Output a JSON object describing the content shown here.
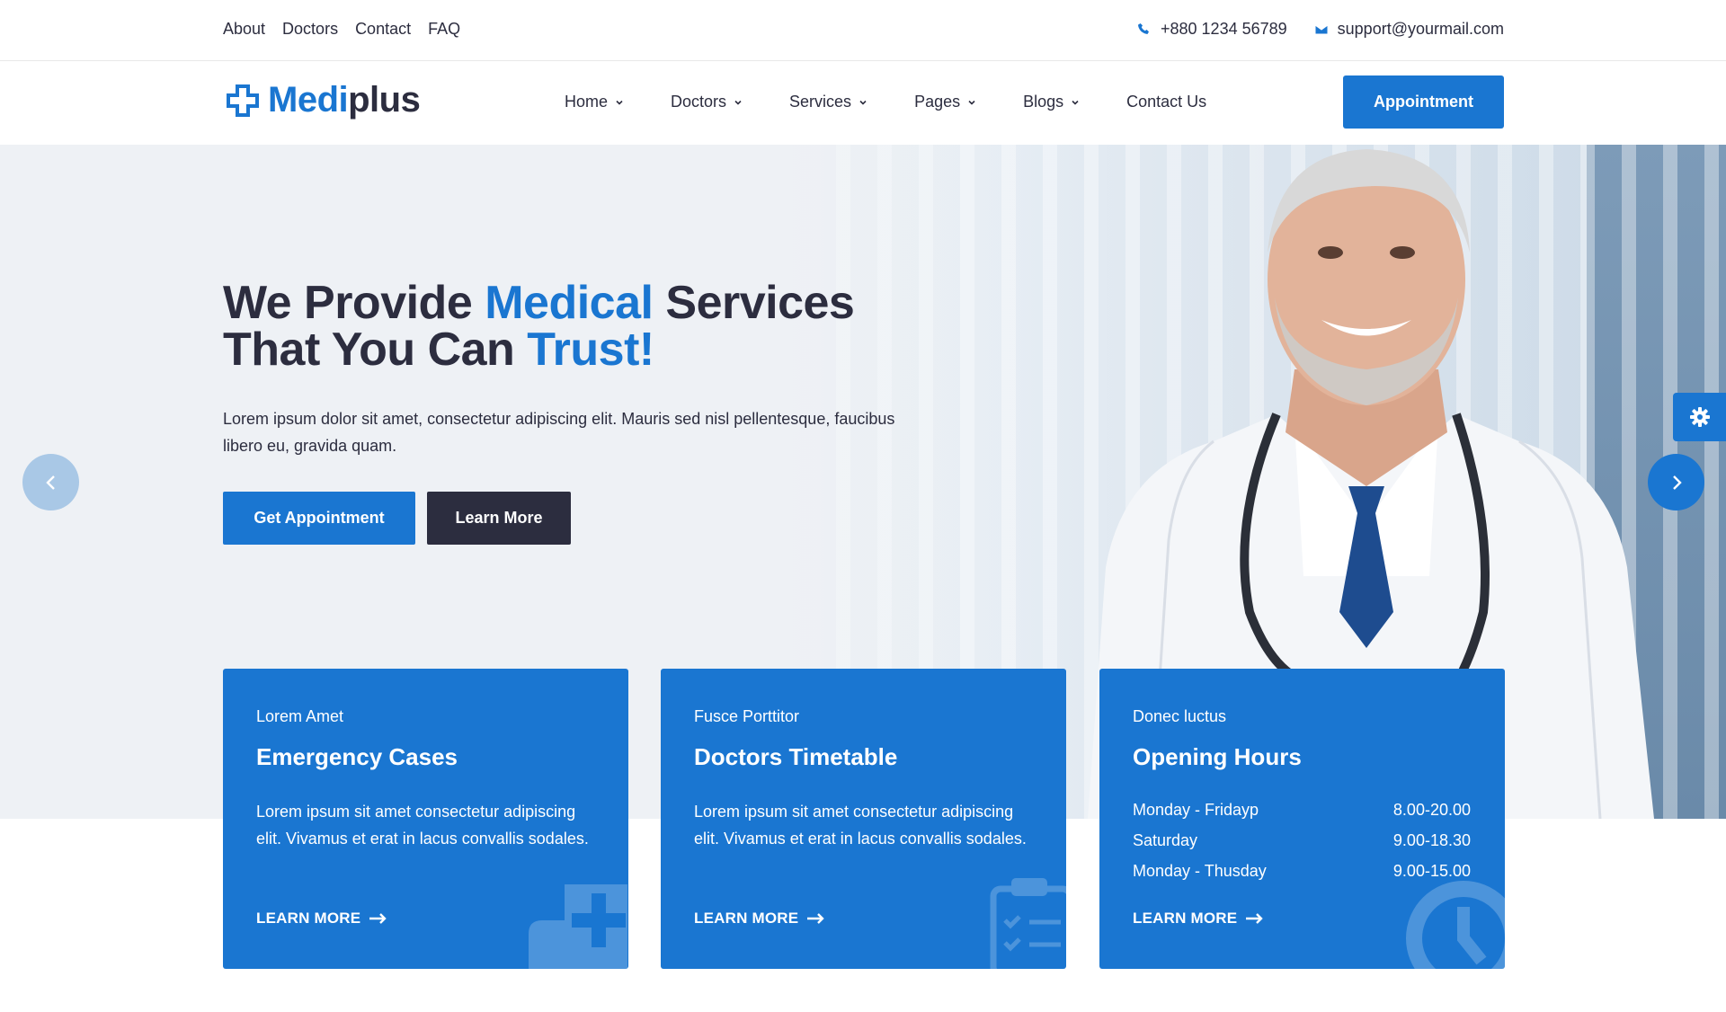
{
  "topbar": {
    "links": [
      "About",
      "Doctors",
      "Contact",
      "FAQ"
    ],
    "phone": "+880 1234 56789",
    "email": "support@yourmail.com"
  },
  "header": {
    "logo_part1": "Medi",
    "logo_part2": "plus",
    "nav": [
      "Home",
      "Doctors",
      "Services",
      "Pages",
      "Blogs",
      "Contact Us"
    ],
    "appointment_label": "Appointment"
  },
  "hero": {
    "title_1": "We Provide ",
    "title_2": "Medical",
    "title_3": " Services",
    "title_4": "That You Can ",
    "title_5": "Trust!",
    "description": "Lorem ipsum dolor sit amet, consectetur adipiscing elit. Mauris sed nisl pellentesque, faucibus libero eu, gravida quam.",
    "get_appointment_label": "Get Appointment",
    "learn_more_label": "Learn More"
  },
  "cards": [
    {
      "kicker": "Lorem Amet",
      "title": "Emergency Cases",
      "text": "Lorem ipsum sit amet consectetur adipiscing elit. Vivamus et erat in lacus convallis sodales.",
      "more": "LEARN MORE"
    },
    {
      "kicker": "Fusce Porttitor",
      "title": "Doctors Timetable",
      "text": "Lorem ipsum sit amet consectetur adipiscing elit. Vivamus et erat in lacus convallis sodales.",
      "more": "LEARN MORE"
    },
    {
      "kicker": "Donec luctus",
      "title": "Opening Hours",
      "hours": [
        {
          "day": "Monday - Fridayp",
          "time": "8.00-20.00"
        },
        {
          "day": "Saturday",
          "time": "9.00-18.30"
        },
        {
          "day": "Monday - Thusday",
          "time": "9.00-15.00"
        }
      ],
      "more": "LEARN MORE"
    }
  ],
  "colors": {
    "primary": "#1a76d1",
    "dark": "#2c2d3f"
  }
}
